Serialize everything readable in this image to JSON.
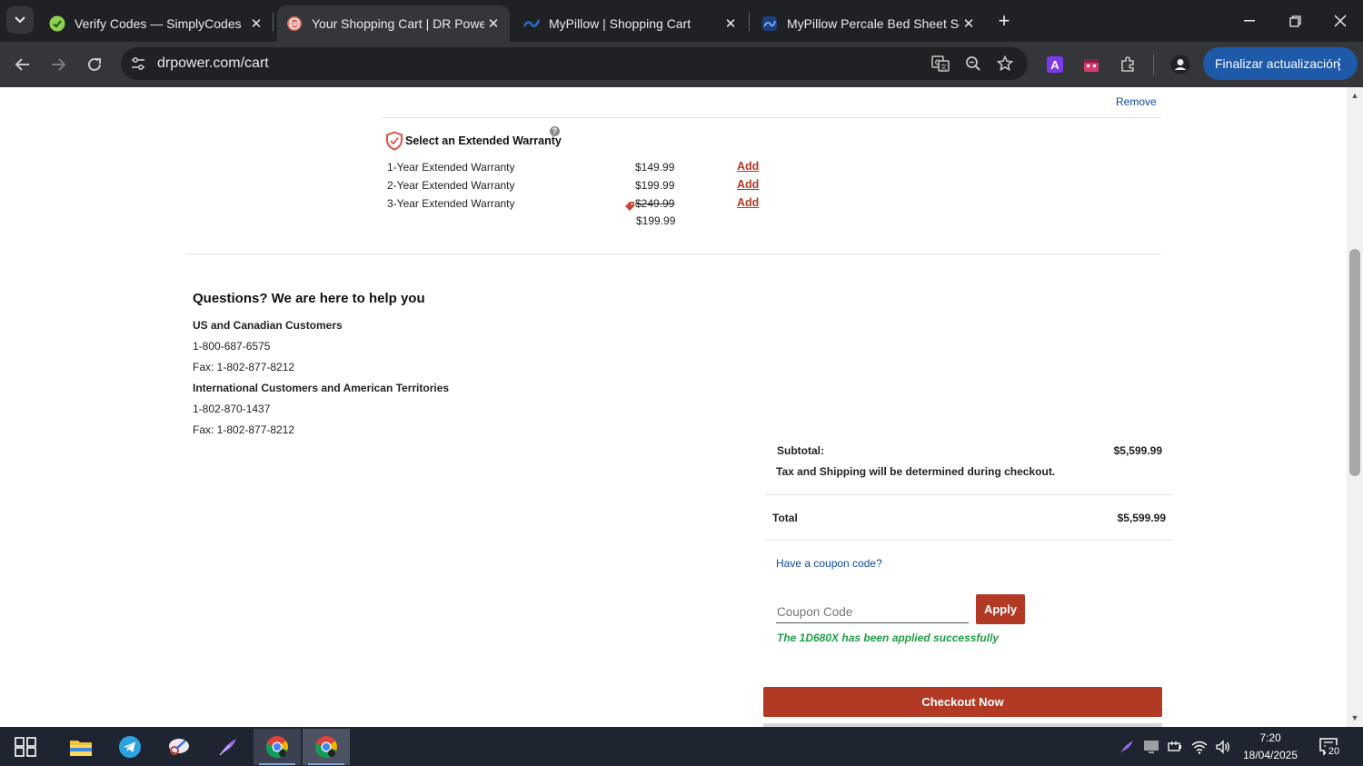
{
  "browser": {
    "tabs": [
      {
        "title": "Verify Codes — SimplyCodes",
        "icon": "simplycodes-favicon"
      },
      {
        "title": "Your Shopping Cart | DR Power",
        "icon": "drpower-favicon",
        "active": true
      },
      {
        "title": "MyPillow | Shopping Cart",
        "icon": "mypillow-favicon"
      },
      {
        "title": "MyPillow Percale Bed Sheet Set",
        "icon": "mypillow-favicon"
      }
    ],
    "url": "drpower.com/cart",
    "update_button": "Finalizar actualización"
  },
  "cart": {
    "remove_label": "Remove",
    "warranty": {
      "heading": "Select an Extended Warranty",
      "help_mark": "?",
      "options": [
        {
          "name": "1-Year Extended Warranty",
          "price": "$149.99",
          "action": "Add"
        },
        {
          "name": "2-Year Extended Warranty",
          "price": "$199.99",
          "action": "Add"
        },
        {
          "name": "3-Year Extended Warranty",
          "price": "$249.99",
          "sale_price": "$199.99",
          "action": "Add"
        }
      ]
    }
  },
  "help": {
    "heading": "Questions? We are here to help you",
    "us_heading": "US and Canadian Customers",
    "us_phone": "1-800-687-6575",
    "us_fax": "Fax: 1-802-877-8212",
    "intl_heading": "International Customers and American Territories",
    "intl_phone": "1-802-870-1437",
    "intl_fax": "Fax: 1-802-877-8212"
  },
  "summary": {
    "subtotal_label": "Subtotal:",
    "subtotal_value": "$5,599.99",
    "tax_note": "Tax and Shipping will be determined during checkout.",
    "total_label": "Total",
    "total_value": "$5,599.99",
    "coupon_link": "Have a coupon code?",
    "coupon_placeholder": "Coupon Code",
    "apply_label": "Apply",
    "coupon_success": "The 1D680X has been applied successfully",
    "checkout_label": "Checkout Now"
  },
  "taskbar": {
    "time": "7:20",
    "date": "18/04/2025",
    "notifications": "20"
  },
  "colors": {
    "brand_red": "#b23a25",
    "link_blue": "#0b4a9e",
    "success_green": "#1f9e47",
    "chrome_dark": "#202124",
    "update_blue": "#1e5aa8"
  }
}
